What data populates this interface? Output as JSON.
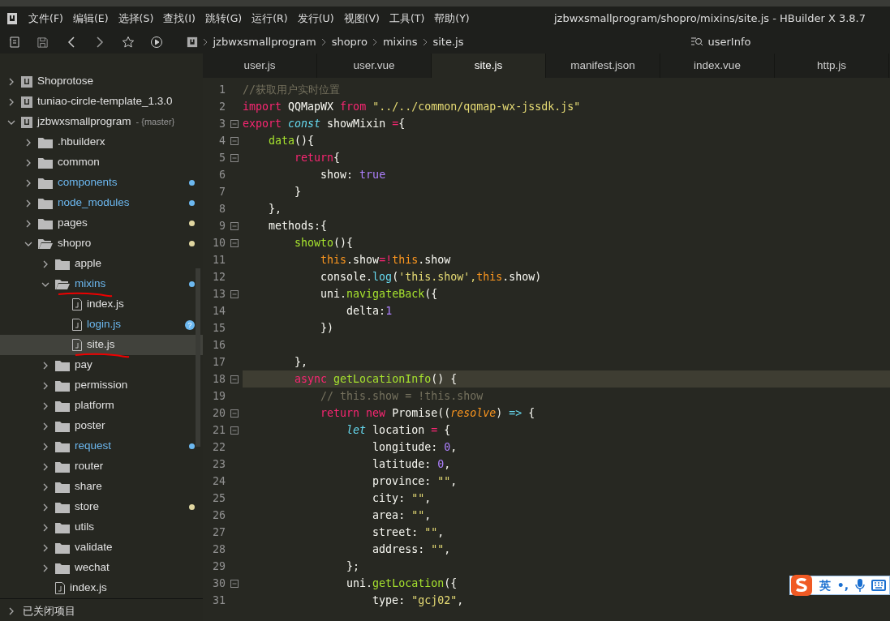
{
  "menu_bar": {
    "items": [
      "文件(F)",
      "编辑(E)",
      "选择(S)",
      "查找(I)",
      "跳转(G)",
      "运行(R)",
      "发行(U)",
      "视图(V)",
      "工具(T)",
      "帮助(Y)"
    ],
    "title": "jzbwxsmallprogram/shopro/mixins/site.js - HBuilder X 3.8.7"
  },
  "toolbar": {
    "breadcrumb": [
      "jzbwxsmallprogram",
      "shopro",
      "mixins",
      "site.js"
    ],
    "search": {
      "value": "userInfo"
    }
  },
  "tree": [
    {
      "name": "Shoprotose",
      "kind": "project",
      "expanded": false,
      "selected": false,
      "modified": false
    },
    {
      "name": "tuniao-circle-template_1.3.0",
      "kind": "project",
      "expanded": false,
      "selected": false,
      "modified": false
    },
    {
      "name": "jzbwxsmallprogram",
      "kind": "project",
      "branch": "- {master}",
      "expanded": true,
      "selected": false,
      "modified": false,
      "children": [
        {
          "name": ".hbuilderx",
          "kind": "folder",
          "expanded": false,
          "selected": false,
          "modified": false
        },
        {
          "name": "common",
          "kind": "folder",
          "expanded": false,
          "selected": false,
          "modified": false
        },
        {
          "name": "components",
          "kind": "folder",
          "expanded": false,
          "selected": false,
          "modified": true,
          "color": "#6cb8f0"
        },
        {
          "name": "node_modules",
          "kind": "folder",
          "expanded": false,
          "selected": false,
          "modified": true,
          "color": "#6cb8f0"
        },
        {
          "name": "pages",
          "kind": "folder",
          "expanded": false,
          "selected": false,
          "modified": false,
          "color": "#e0d6a0"
        },
        {
          "name": "shopro",
          "kind": "folder",
          "expanded": true,
          "selected": false,
          "modified": false,
          "color": "#e0d6a0",
          "children": [
            {
              "name": "apple",
              "kind": "folder",
              "expanded": false,
              "selected": false,
              "modified": false
            },
            {
              "name": "mixins",
              "kind": "folder",
              "expanded": true,
              "selected": false,
              "modified": true,
              "color": "#6cb8f0",
              "annotated": true,
              "children": [
                {
                  "name": "index.js",
                  "kind": "file",
                  "selected": false,
                  "modified": false
                },
                {
                  "name": "login.js",
                  "kind": "file",
                  "selected": false,
                  "modified": true,
                  "badge": "?"
                },
                {
                  "name": "site.js",
                  "kind": "file",
                  "selected": true,
                  "modified": false,
                  "annotated": true
                }
              ]
            },
            {
              "name": "pay",
              "kind": "folder",
              "expanded": false,
              "selected": false,
              "modified": false
            },
            {
              "name": "permission",
              "kind": "folder",
              "expanded": false,
              "selected": false,
              "modified": false
            },
            {
              "name": "platform",
              "kind": "folder",
              "expanded": false,
              "selected": false,
              "modified": false
            },
            {
              "name": "poster",
              "kind": "folder",
              "expanded": false,
              "selected": false,
              "modified": false
            },
            {
              "name": "request",
              "kind": "folder",
              "expanded": false,
              "selected": false,
              "modified": true,
              "color": "#6cb8f0"
            },
            {
              "name": "router",
              "kind": "folder",
              "expanded": false,
              "selected": false,
              "modified": false
            },
            {
              "name": "share",
              "kind": "folder",
              "expanded": false,
              "selected": false,
              "modified": false
            },
            {
              "name": "store",
              "kind": "folder",
              "expanded": false,
              "selected": false,
              "modified": false,
              "color": "#e0d6a0"
            },
            {
              "name": "utils",
              "kind": "folder",
              "expanded": false,
              "selected": false,
              "modified": false
            },
            {
              "name": "validate",
              "kind": "folder",
              "expanded": false,
              "selected": false,
              "modified": false
            },
            {
              "name": "wechat",
              "kind": "folder",
              "expanded": false,
              "selected": false,
              "modified": false
            },
            {
              "name": "index.js",
              "kind": "file",
              "selected": false,
              "modified": false
            }
          ]
        }
      ]
    }
  ],
  "closed_projects": {
    "label": "已关闭项目",
    "expanded": false
  },
  "tabs": [
    {
      "label": "user.js",
      "selected": false
    },
    {
      "label": "user.vue",
      "selected": false
    },
    {
      "label": "site.js",
      "selected": true
    },
    {
      "label": "manifest.json",
      "selected": false
    },
    {
      "label": "index.vue",
      "selected": false
    },
    {
      "label": "http.js",
      "selected": false
    }
  ],
  "code": [
    {
      "number": "1",
      "fold": false,
      "current": false,
      "tokens": [
        {
          "kind": "comment",
          "text": "//获取用户实时位置"
        }
      ]
    },
    {
      "number": "2",
      "fold": false,
      "current": false,
      "tokens": [
        {
          "kind": "keyword",
          "text": "import"
        },
        {
          "kind": "plain",
          "text": " QQMapWX "
        },
        {
          "kind": "keyword",
          "text": "from"
        },
        {
          "kind": "string",
          "text": " \"../../common/qqmap-wx-jssdk.js\""
        }
      ]
    },
    {
      "number": "3",
      "fold": true,
      "current": false,
      "tokens": [
        {
          "kind": "keyword",
          "text": "export"
        },
        {
          "kind": "storage",
          "text": " const"
        },
        {
          "kind": "plain",
          "text": " showMixin "
        },
        {
          "kind": "keyword",
          "text": "="
        },
        {
          "kind": "plain",
          "text": "{"
        }
      ]
    },
    {
      "number": "4",
      "fold": true,
      "current": false,
      "tokens": [
        {
          "kind": "function",
          "text": "    data"
        },
        {
          "kind": "plain",
          "text": "(){"
        }
      ]
    },
    {
      "number": "5",
      "fold": true,
      "current": false,
      "tokens": [
        {
          "kind": "keyword",
          "text": "        return"
        },
        {
          "kind": "plain",
          "text": "{"
        }
      ]
    },
    {
      "number": "6",
      "fold": false,
      "current": false,
      "tokens": [
        {
          "kind": "plain",
          "text": "            show: "
        },
        {
          "kind": "number",
          "text": "true"
        }
      ]
    },
    {
      "number": "7",
      "fold": false,
      "current": false,
      "tokens": [
        {
          "kind": "plain",
          "text": "        }"
        }
      ]
    },
    {
      "number": "8",
      "fold": false,
      "current": false,
      "tokens": [
        {
          "kind": "plain",
          "text": "    },"
        }
      ]
    },
    {
      "number": "9",
      "fold": true,
      "current": false,
      "tokens": [
        {
          "kind": "plain",
          "text": "    methods:{"
        }
      ]
    },
    {
      "number": "10",
      "fold": true,
      "current": false,
      "tokens": [
        {
          "kind": "function",
          "text": "        showto"
        },
        {
          "kind": "plain",
          "text": "(){"
        }
      ]
    },
    {
      "number": "11",
      "fold": false,
      "current": false,
      "tokens": [
        {
          "kind": "this",
          "text": "            this"
        },
        {
          "kind": "plain",
          "text": ".show"
        },
        {
          "kind": "keyword",
          "text": "=!"
        },
        {
          "kind": "this",
          "text": "this"
        },
        {
          "kind": "plain",
          "text": ".show"
        }
      ]
    },
    {
      "number": "12",
      "fold": false,
      "current": false,
      "tokens": [
        {
          "kind": "plain",
          "text": "            console."
        },
        {
          "kind": "support",
          "text": "log"
        },
        {
          "kind": "plain",
          "text": "("
        },
        {
          "kind": "string",
          "text": "'this.show',"
        },
        {
          "kind": "this",
          "text": "this"
        },
        {
          "kind": "plain",
          "text": ".show)"
        }
      ]
    },
    {
      "number": "13",
      "fold": true,
      "current": false,
      "tokens": [
        {
          "kind": "plain",
          "text": "            uni."
        },
        {
          "kind": "function",
          "text": "navigateBack"
        },
        {
          "kind": "plain",
          "text": "({"
        }
      ]
    },
    {
      "number": "14",
      "fold": false,
      "current": false,
      "tokens": [
        {
          "kind": "plain",
          "text": "                delta:"
        },
        {
          "kind": "number",
          "text": "1"
        }
      ]
    },
    {
      "number": "15",
      "fold": false,
      "current": false,
      "tokens": [
        {
          "kind": "plain",
          "text": "            })"
        }
      ]
    },
    {
      "number": "16",
      "fold": false,
      "current": false
    },
    {
      "number": "17",
      "fold": false,
      "current": false,
      "tokens": [
        {
          "kind": "plain",
          "text": "        },"
        }
      ]
    },
    {
      "number": "18",
      "fold": true,
      "current": true,
      "tokens": [
        {
          "kind": "keyword",
          "text": "        async"
        },
        {
          "kind": "function",
          "text": " getLocationInfo"
        },
        {
          "kind": "plain",
          "text": "() {"
        }
      ]
    },
    {
      "number": "19",
      "fold": false,
      "current": false,
      "tokens": [
        {
          "kind": "comment",
          "text": "            // this.show = !this.show"
        }
      ]
    },
    {
      "number": "20",
      "fold": true,
      "current": false,
      "tokens": [
        {
          "kind": "keyword",
          "text": "            return new"
        },
        {
          "kind": "plain",
          "text": " Promise(("
        },
        {
          "kind": "param",
          "text": "resolve"
        },
        {
          "kind": "plain",
          "text": ") "
        },
        {
          "kind": "storage",
          "text": "=>"
        },
        {
          "kind": "plain",
          "text": " {"
        }
      ]
    },
    {
      "number": "21",
      "fold": true,
      "current": false,
      "tokens": [
        {
          "kind": "storage",
          "text": "                let"
        },
        {
          "kind": "plain",
          "text": " location "
        },
        {
          "kind": "keyword",
          "text": "="
        },
        {
          "kind": "plain",
          "text": " {"
        }
      ]
    },
    {
      "number": "22",
      "fold": false,
      "current": false,
      "tokens": [
        {
          "kind": "plain",
          "text": "                    longitude: "
        },
        {
          "kind": "number",
          "text": "0"
        },
        {
          "kind": "plain",
          "text": ","
        }
      ]
    },
    {
      "number": "23",
      "fold": false,
      "current": false,
      "tokens": [
        {
          "kind": "plain",
          "text": "                    latitude: "
        },
        {
          "kind": "number",
          "text": "0"
        },
        {
          "kind": "plain",
          "text": ","
        }
      ]
    },
    {
      "number": "24",
      "fold": false,
      "current": false,
      "tokens": [
        {
          "kind": "plain",
          "text": "                    province: "
        },
        {
          "kind": "string",
          "text": "\"\""
        },
        {
          "kind": "plain",
          "text": ","
        }
      ]
    },
    {
      "number": "25",
      "fold": false,
      "current": false,
      "tokens": [
        {
          "kind": "plain",
          "text": "                    city: "
        },
        {
          "kind": "string",
          "text": "\"\""
        },
        {
          "kind": "plain",
          "text": ","
        }
      ]
    },
    {
      "number": "26",
      "fold": false,
      "current": false,
      "tokens": [
        {
          "kind": "plain",
          "text": "                    area: "
        },
        {
          "kind": "string",
          "text": "\"\""
        },
        {
          "kind": "plain",
          "text": ","
        }
      ]
    },
    {
      "number": "27",
      "fold": false,
      "current": false,
      "tokens": [
        {
          "kind": "plain",
          "text": "                    street: "
        },
        {
          "kind": "string",
          "text": "\"\""
        },
        {
          "kind": "plain",
          "text": ","
        }
      ]
    },
    {
      "number": "28",
      "fold": false,
      "current": false,
      "tokens": [
        {
          "kind": "plain",
          "text": "                    address: "
        },
        {
          "kind": "string",
          "text": "\"\""
        },
        {
          "kind": "plain",
          "text": ","
        }
      ]
    },
    {
      "number": "29",
      "fold": false,
      "current": false,
      "tokens": [
        {
          "kind": "plain",
          "text": "                };"
        }
      ]
    },
    {
      "number": "30",
      "fold": true,
      "current": false,
      "tokens": [
        {
          "kind": "plain",
          "text": "                uni."
        },
        {
          "kind": "function",
          "text": "getLocation"
        },
        {
          "kind": "plain",
          "text": "({"
        }
      ]
    },
    {
      "number": "31",
      "fold": false,
      "current": false,
      "tokens": [
        {
          "kind": "plain",
          "text": "                    type: "
        },
        {
          "kind": "string",
          "text": "\"gcj02\""
        },
        {
          "kind": "plain",
          "text": ","
        }
      ]
    }
  ],
  "ime_toolbar": {
    "items": [
      "英",
      "•,"
    ]
  }
}
